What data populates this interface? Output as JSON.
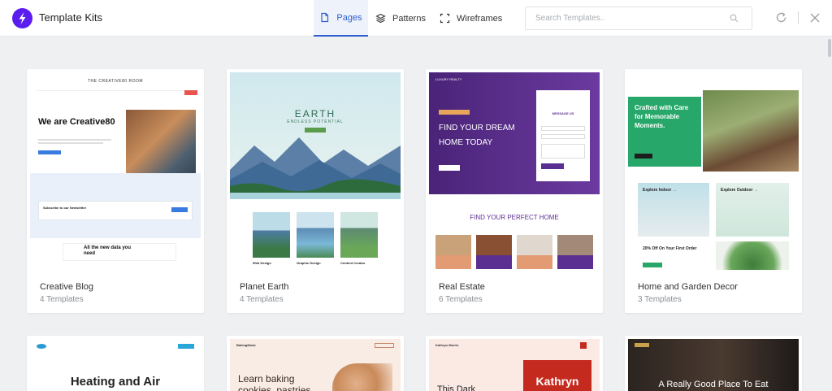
{
  "header": {
    "title": "Template Kits",
    "tabs": [
      {
        "label": "Pages"
      },
      {
        "label": "Patterns"
      },
      {
        "label": "Wireframes"
      }
    ],
    "search": {
      "placeholder": "Search Templates..",
      "value": ""
    }
  },
  "cards": [
    {
      "name": "Creative Blog",
      "count": "4 Templates",
      "preview": {
        "brand": "THE CREATIVE80 ROOM",
        "heading": "We are Creative80",
        "newsletter": "Subscribe to our Newsletter",
        "promo": "All the new data you need"
      }
    },
    {
      "name": "Planet Earth",
      "count": "4 Templates",
      "preview": {
        "brand": "EARTH",
        "hero_title": "EARTH",
        "hero_subtitle": "ENDLESS POTENTIAL",
        "items": [
          "Web Design",
          "Graphic Design",
          "Content Creator"
        ]
      }
    },
    {
      "name": "Real Estate",
      "count": "6 Templates",
      "preview": {
        "brand": "LUXURY REALTY",
        "hero": "FIND YOUR DREAM HOME TODAY",
        "form_title": "MESSAGE US",
        "section": "FIND YOUR PERFECT HOME"
      }
    },
    {
      "name": "Home and Garden Decor",
      "count": "3 Templates",
      "preview": {
        "hero": "Crafted with Care for Memorable Moments.",
        "box1": "Explore Indoor →",
        "box2": "Explore Outdoor →",
        "offer": "20% Off On Your First Order"
      }
    },
    {
      "name": "",
      "count": "",
      "preview": {
        "heading": "Heating and Air"
      }
    },
    {
      "name": "",
      "count": "",
      "preview": {
        "brand": "BakingMode",
        "heading": "Learn baking cookies, pastries"
      }
    },
    {
      "name": "",
      "count": "",
      "preview": {
        "brand": "Kathryn Morris",
        "heading": "This Dark",
        "cover": "Kathryn"
      }
    },
    {
      "name": "",
      "count": "",
      "preview": {
        "heading": "A Really Good Place To Eat"
      }
    }
  ],
  "colors": {
    "accent": "#2f5fd0",
    "brand": "#5b1cf0",
    "real_estate_purple": "#5b2e91",
    "garden_green": "#27a86a"
  }
}
